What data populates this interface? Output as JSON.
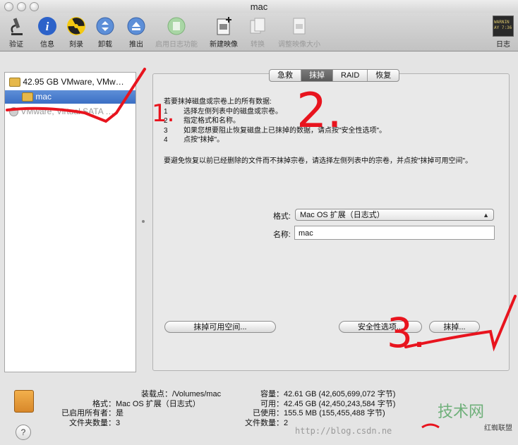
{
  "window": {
    "title": "mac"
  },
  "toolbar": {
    "items": [
      {
        "label": "验证",
        "icon": "microscope-icon"
      },
      {
        "label": "信息",
        "icon": "info-icon"
      },
      {
        "label": "刻录",
        "icon": "burn-icon"
      },
      {
        "label": "卸载",
        "icon": "unmount-icon"
      },
      {
        "label": "推出",
        "icon": "eject-icon"
      },
      {
        "label": "启用日志功能",
        "icon": "journal-icon",
        "disabled": true
      },
      {
        "label": "新建映像",
        "icon": "new-image-icon"
      },
      {
        "label": "转换",
        "icon": "convert-icon",
        "disabled": true
      },
      {
        "label": "调整映像大小",
        "icon": "resize-image-icon",
        "disabled": true
      }
    ],
    "log_label": "日志",
    "log_icon_text": "WARNIN\nAY 7:36"
  },
  "sidebar": {
    "items": [
      {
        "label": "42.95 GB VMware, VMw…"
      },
      {
        "label": "mac",
        "selected": true
      },
      {
        "label": "VMware, Virtual SATA …"
      }
    ]
  },
  "tabs": [
    {
      "label": "急救"
    },
    {
      "label": "抹掉",
      "active": true
    },
    {
      "label": "RAID"
    },
    {
      "label": "恢复"
    }
  ],
  "erase": {
    "intro": "若要抹掉磁盘或宗卷上的所有数据:",
    "steps": [
      {
        "num": "1",
        "text": "选择左侧列表中的磁盘或宗卷。"
      },
      {
        "num": "2",
        "text": "指定格式和名称。"
      },
      {
        "num": "3",
        "text": "如果您想要阻止恢复磁盘上已抹掉的数据，请点按\"安全性选项\"。"
      },
      {
        "num": "4",
        "text": "点按\"抹掉\"。"
      }
    ],
    "note": "要避免恢复以前已经删除的文件而不抹掉宗卷，请选择左侧列表中的宗卷，并点按\"抹掉可用空间\"。",
    "format_label": "格式:",
    "format_value": "Mac OS 扩展（日志式）",
    "name_label": "名称:",
    "name_value": "mac",
    "btn_free_space": "抹掉可用空间...",
    "btn_security": "安全性选项...",
    "btn_erase": "抹掉..."
  },
  "info_left": [
    {
      "k": "装载点：",
      "v": "/Volumes/mac"
    },
    {
      "k": "格式：",
      "v": "Mac OS 扩展（日志式）"
    },
    {
      "k": "已启用所有者：",
      "v": "是"
    },
    {
      "k": "文件夹数量：",
      "v": "3"
    }
  ],
  "info_right": [
    {
      "k": "容量：",
      "v": "42.61 GB (42,605,699,072 字节)"
    },
    {
      "k": "可用：",
      "v": "42.45 GB (42,450,243,584 字节)"
    },
    {
      "k": "已使用：",
      "v": "155.5 MB (155,455,488 字节)"
    },
    {
      "k": "文件数量：",
      "v": "2"
    }
  ],
  "watermark": {
    "url": "http://blog.csdn.ne",
    "site": "技术网",
    "sub": "红蜘联盟"
  },
  "annotations": {
    "a1": "1.",
    "a2": "2.",
    "a3": "3."
  },
  "colors": {
    "selection": "#3b6fc4",
    "annotation": "#e8141e"
  }
}
